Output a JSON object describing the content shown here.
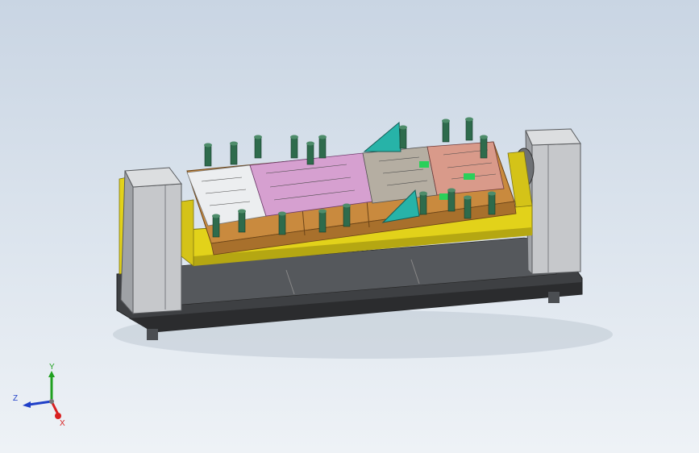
{
  "viewport": {
    "background_top": "#c9d5e3",
    "background_bottom": "#eef2f6"
  },
  "model": {
    "colors": {
      "yellow": "#e2d21a",
      "grey_column": "#b9bbbe",
      "dark_base": "#3e4043",
      "die_plate": "#c98a3e",
      "pink_strip": "#d6a0d0",
      "teal": "#27b3a8",
      "green_post": "#2e6b4c"
    }
  },
  "triad": {
    "x_label": "X",
    "y_label": "Y",
    "z_label": "Z",
    "x_color": "#d82020",
    "y_color": "#20a020",
    "z_color": "#2040c8"
  }
}
